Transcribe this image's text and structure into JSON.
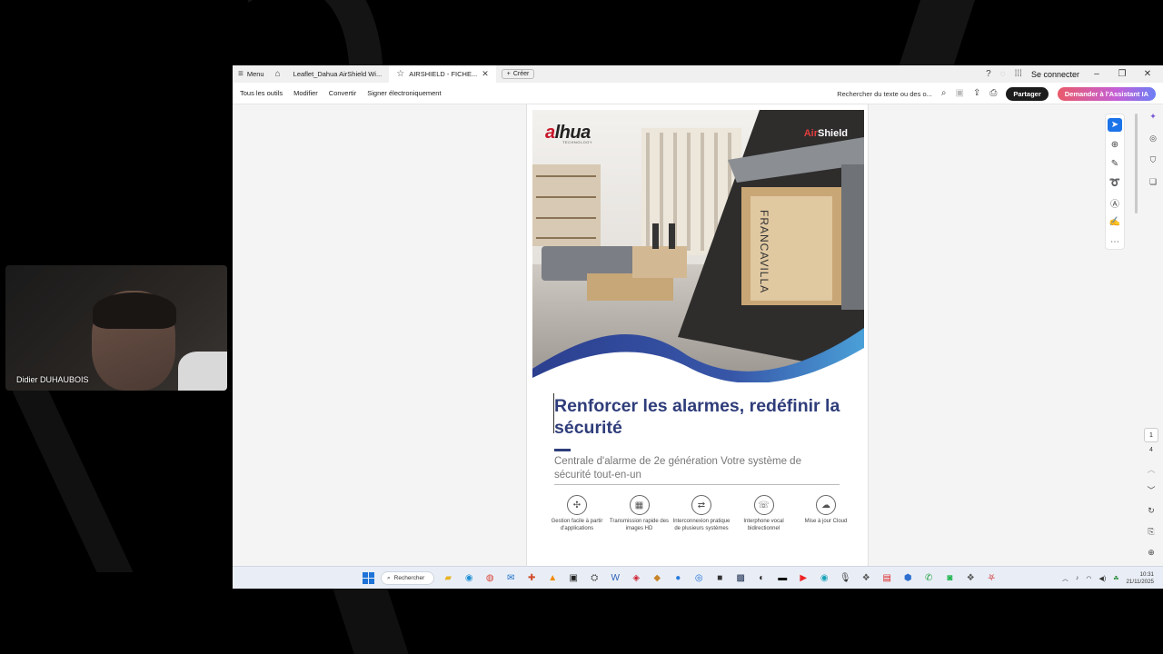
{
  "webcam": {
    "name": "Didier DUHAUBOIS"
  },
  "tabbar": {
    "menu_label": "Menu",
    "tabs": [
      {
        "label": "Leaflet_Dahua AirShield Wi...",
        "active": false
      },
      {
        "label": "AIRSHIELD - FICHE...",
        "active": true
      }
    ],
    "new_label": "Créer",
    "connect_label": "Se connecter"
  },
  "toolbar": {
    "tools": [
      "Tous les outils",
      "Modifier",
      "Convertir",
      "Signer électroniquement"
    ],
    "search_label": "Rechercher du texte ou des o...",
    "share_label": "Partager",
    "ai_label": "Demander à l'Assistant IA"
  },
  "document": {
    "brand_logo": "alhua",
    "brand_sub": "TECHNOLOGY",
    "product_logo_air": "Air",
    "product_logo_shield": "Shield",
    "storefront_text": "FRANCAVILLA",
    "title": "Renforcer les alarmes, redéfinir la sécurité",
    "subtitle": "Centrale d'alarme de 2e génération Votre système de sécurité tout-en-un",
    "features": [
      {
        "icon": "app-control-icon",
        "glyph": "✣",
        "label": "Gestion facile à partir d'applications"
      },
      {
        "icon": "hd-image-icon",
        "glyph": "▦",
        "label": "Transmission rapide des images HD"
      },
      {
        "icon": "interconnect-icon",
        "glyph": "⇄",
        "label": "Interconnexion pratique de plusieurs systèmes"
      },
      {
        "icon": "voice-intercom-icon",
        "glyph": "☏",
        "label": "Interphone vocal bidirectionnel"
      },
      {
        "icon": "cloud-update-icon",
        "glyph": "☁",
        "label": "Mise à jour Cloud"
      }
    ]
  },
  "navigation": {
    "current_page": "1",
    "total_pages": "4"
  },
  "taskbar": {
    "search_label": "Rechercher",
    "time": "10:31",
    "date": "21/11/2025"
  },
  "colors": {
    "title_blue": "#2f3d7a",
    "accent_red": "#c8172a",
    "active_tool": "#1a73e8"
  }
}
